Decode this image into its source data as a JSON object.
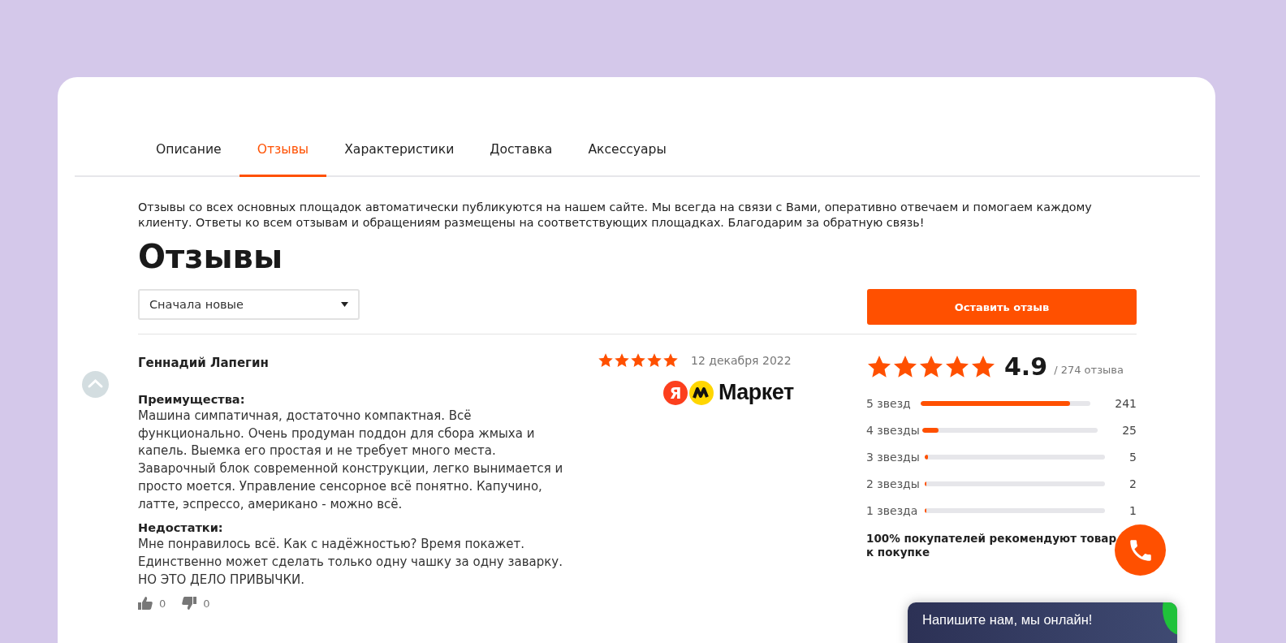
{
  "tabs": [
    {
      "label": "Описание",
      "selected": false
    },
    {
      "label": "Отзывы",
      "selected": true
    },
    {
      "label": "Характеристики",
      "selected": false
    },
    {
      "label": "Доставка",
      "selected": false
    },
    {
      "label": "Аксессуары",
      "selected": false
    }
  ],
  "intro": "Отзывы со всех основных площадок автоматически публикуются на нашем сайте. Мы всегда на связи с Вами, оперативно отвечаем и помогаем каждому клиенту. Ответы ко всем отзывам и обращениям размещены на соответствующих площадках. Благодарим за обратную связь!",
  "heading": "Отзывы",
  "sort_select": {
    "value": "Сначала новые"
  },
  "leave_review_button": "Оставить отзыв",
  "review": {
    "author": "Геннадий Лапегин",
    "stars": 5,
    "date": "12 декабря 2022",
    "source_logo": {
      "letter": "Я",
      "text": "Маркет"
    },
    "sections": [
      {
        "title": "Преимущества:",
        "text": "Машина симпатичная, достаточно компактная. Всё функционально. Очень продуман поддон для сбора жмыха и капель. Выемка его простая и не требует много места. Заварочный блок современной конструкции, легко вынимается и просто моется. Управление сенсорное всё понятно. Капучино, латте, эспрессо, американо - можно всё."
      },
      {
        "title": "Недостатки:",
        "text": "Мне понравилось всё. Как с надёжностью? Время покажет. Единственно может сделать только одну чашку за одну заварку. НО ЭТО ДЕЛО ПРИВЫЧКИ."
      }
    ],
    "likes": "0",
    "dislikes": "0"
  },
  "summary": {
    "stars": 5,
    "rating": "4.9",
    "count": "/ 274 отзыва",
    "breakdown": [
      {
        "label": "5 звезд",
        "level": 0.88,
        "count": "241"
      },
      {
        "label": "4 звезды",
        "level": 0.09,
        "count": "25"
      },
      {
        "label": "3 звезды",
        "level": 0.018,
        "count": "5"
      },
      {
        "label": "2 звезды",
        "level": 0.007,
        "count": "2"
      },
      {
        "label": "1 звезда",
        "level": 0.004,
        "count": "1"
      }
    ],
    "recommend": "100% покупателей рекомендуют товар к покупке"
  },
  "chat": {
    "text": "Напишите нам, мы онлайн!"
  }
}
